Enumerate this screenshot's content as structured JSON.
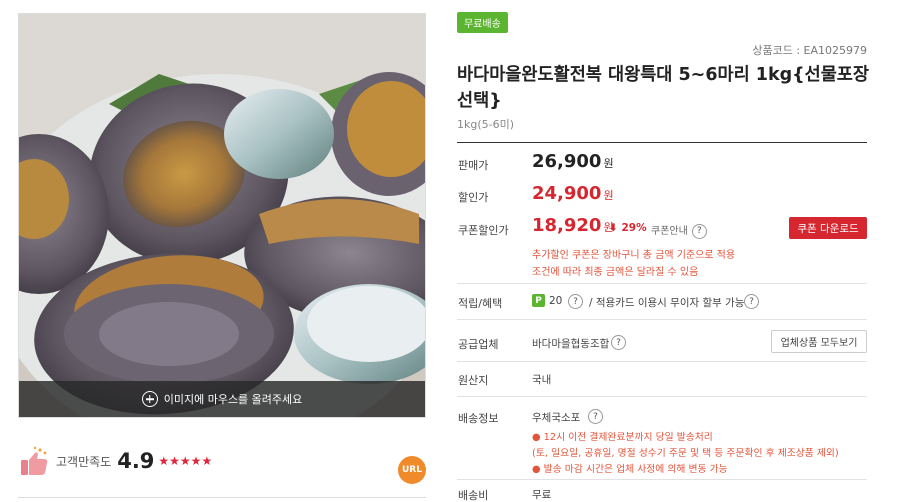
{
  "product": {
    "shipping_badge": "무료배송",
    "code_label": "상품코드 : EA1025979",
    "title": "바다마을완도활전복 대왕특대 5~6마리 1kg{선물포장선택}",
    "option": "1kg(5-6미)"
  },
  "image": {
    "zoom_hint": "이미지에 마우스를 올려주세요"
  },
  "rating": {
    "label": "고객만족도",
    "score": "4.9",
    "stars": "★★★★★",
    "url_badge": "URL"
  },
  "prices": {
    "sale_label": "판매가",
    "sale_value": "26,900",
    "disc_label": "할인가",
    "disc_value": "24,900",
    "coupon_label": "쿠폰할인가",
    "coupon_value": "18,920",
    "won": "원",
    "rate": "⬇ 29%",
    "coupon_info": "쿠폰안내",
    "coupon_button": "쿠폰 다운로드",
    "notice1": "추가할인 쿠폰은 장바구니 총 금액 기준으로 적용",
    "notice2": "조건에 따라 최종 금액은 달라질 수 있음"
  },
  "benefit": {
    "label": "적립/혜택",
    "point_icon": "P",
    "points": "20",
    "card": "/ 적용카드 이용시 무이자 할부 가능"
  },
  "supplier": {
    "label": "공급업체",
    "name": "바다마을협동조합",
    "button": "업체상품 모두보기"
  },
  "origin": {
    "label": "원산지",
    "value": "국내"
  },
  "delivery": {
    "label": "배송정보",
    "method": "우체국소포",
    "note1": "● 12시 이전 결제완료분까지 당일 발송처리",
    "note2": "(토, 일요일, 공휴일, 명절 성수기 주문 및 택 등 주문확인 후 제조상품 제외)",
    "note3": "● 발송 마감 시간은 업체 사정에 의해 변동 가능"
  },
  "fee": {
    "label": "배송비",
    "value": "무료"
  },
  "colors": {
    "accent_red": "#d6262f",
    "badge_green": "#5cb531",
    "url_orange": "#f08a2b"
  },
  "icons": {
    "question": "?",
    "zoom": "plus-circle-icon",
    "thumb": "thumbs-up-icon"
  }
}
